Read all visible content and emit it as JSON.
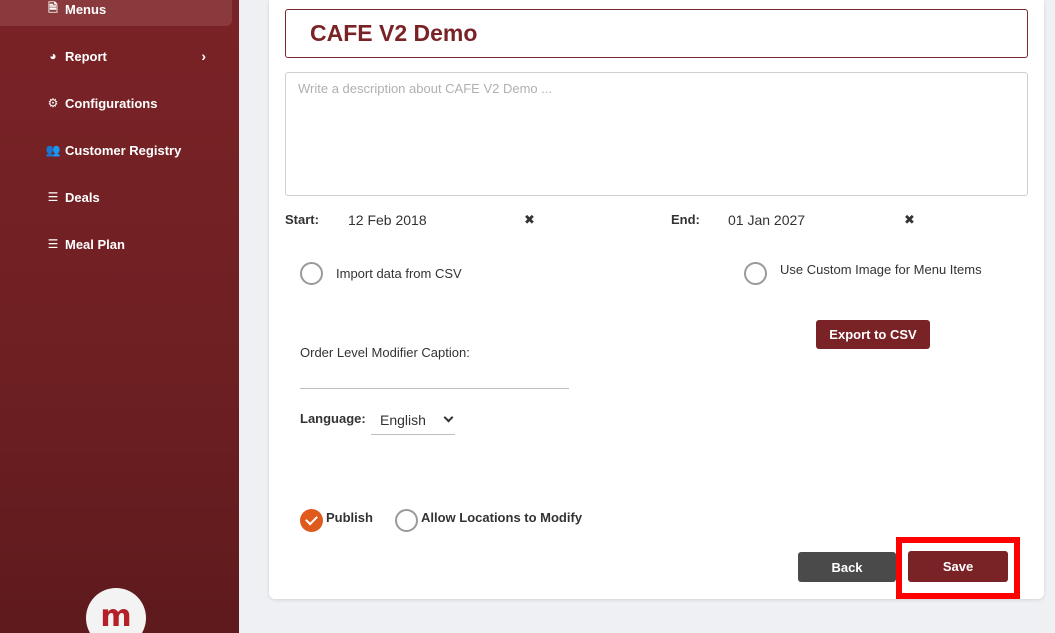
{
  "sidebar": {
    "items": [
      {
        "label": "Menus",
        "icon": "file-icon",
        "glyph": "🗎"
      },
      {
        "label": "Report",
        "icon": "pie-chart-icon",
        "glyph": "◕"
      },
      {
        "label": "Configurations",
        "icon": "gear-icon",
        "glyph": "⚙"
      },
      {
        "label": "Customer Registry",
        "icon": "users-icon",
        "glyph": "👥"
      },
      {
        "label": "Deals",
        "icon": "list-icon",
        "glyph": "☰"
      },
      {
        "label": "Meal Plan",
        "icon": "list-icon",
        "glyph": "☰"
      }
    ],
    "report_chevron": "›",
    "logo_letter": "m"
  },
  "menu": {
    "title": "CAFE V2 Demo",
    "description_placeholder": "Write a description about CAFE V2 Demo ...",
    "start_label": "Start:",
    "start_value": "12 Feb 2018",
    "end_label": "End:",
    "end_value": "01 Jan 2027",
    "clear_glyph": "✖",
    "import_csv_label": "Import data from CSV",
    "custom_image_label": "Use Custom Image for Menu Items",
    "export_button": "Export to CSV",
    "modifier_caption_label": "Order Level Modifier Caption:",
    "language_label": "Language:",
    "language_value": "English",
    "publish_label": "Publish",
    "allow_locations_label": "Allow Locations to Modify",
    "back_button": "Back",
    "save_button": "Save"
  },
  "colors": {
    "brand": "#7a2327",
    "publish_check": "#e05a1e",
    "highlight": "#ff0000"
  }
}
